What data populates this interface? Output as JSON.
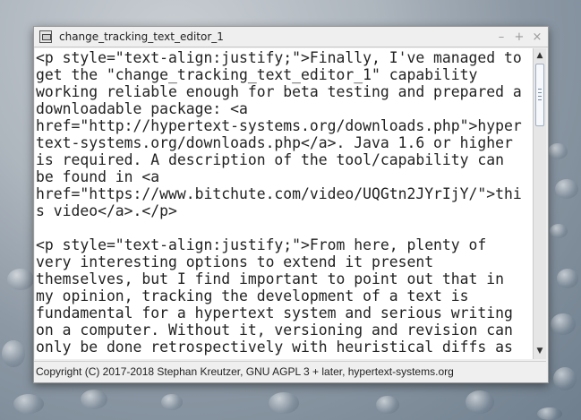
{
  "window": {
    "title": "change_tracking_text_editor_1",
    "buttons": {
      "minimize": "–",
      "maximize": "+",
      "close": "×"
    }
  },
  "editor": {
    "lines": [
      "<p style=\"text-align:justify;\">Finally, I've managed to",
      "get the \"change_tracking_text_editor_1\" capability",
      "working reliable enough for beta testing and prepared a",
      "downloadable package: <a",
      "href=\"http://hypertext-systems.org/downloads.php\">hyper",
      "text-systems.org/downloads.php</a>. Java 1.6 or higher",
      "is required. A description of the tool/capability can",
      "be found in <a",
      "href=\"https://www.bitchute.com/video/UQGtn2JYrIjY/\">thi",
      "s video</a>.</p>",
      "",
      "<p style=\"text-align:justify;\">From here, plenty of",
      "very interesting options to extend it present",
      "themselves, but I find important to point out that in",
      "my opinion, tracking the development of a text is",
      "fundamental for a hypertext system and serious writing",
      "on a computer. Without it, versioning and revision can",
      "only be done retrospectively with heuristical diffs as"
    ]
  },
  "scrollbar": {
    "up_arrow": "▲",
    "down_arrow": "▼",
    "position": 0.0
  },
  "statusbar": {
    "text": "Copyright (C) 2017-2018 Stephan Kreutzer, GNU AGPL 3 + later, hypertext-systems.org"
  }
}
